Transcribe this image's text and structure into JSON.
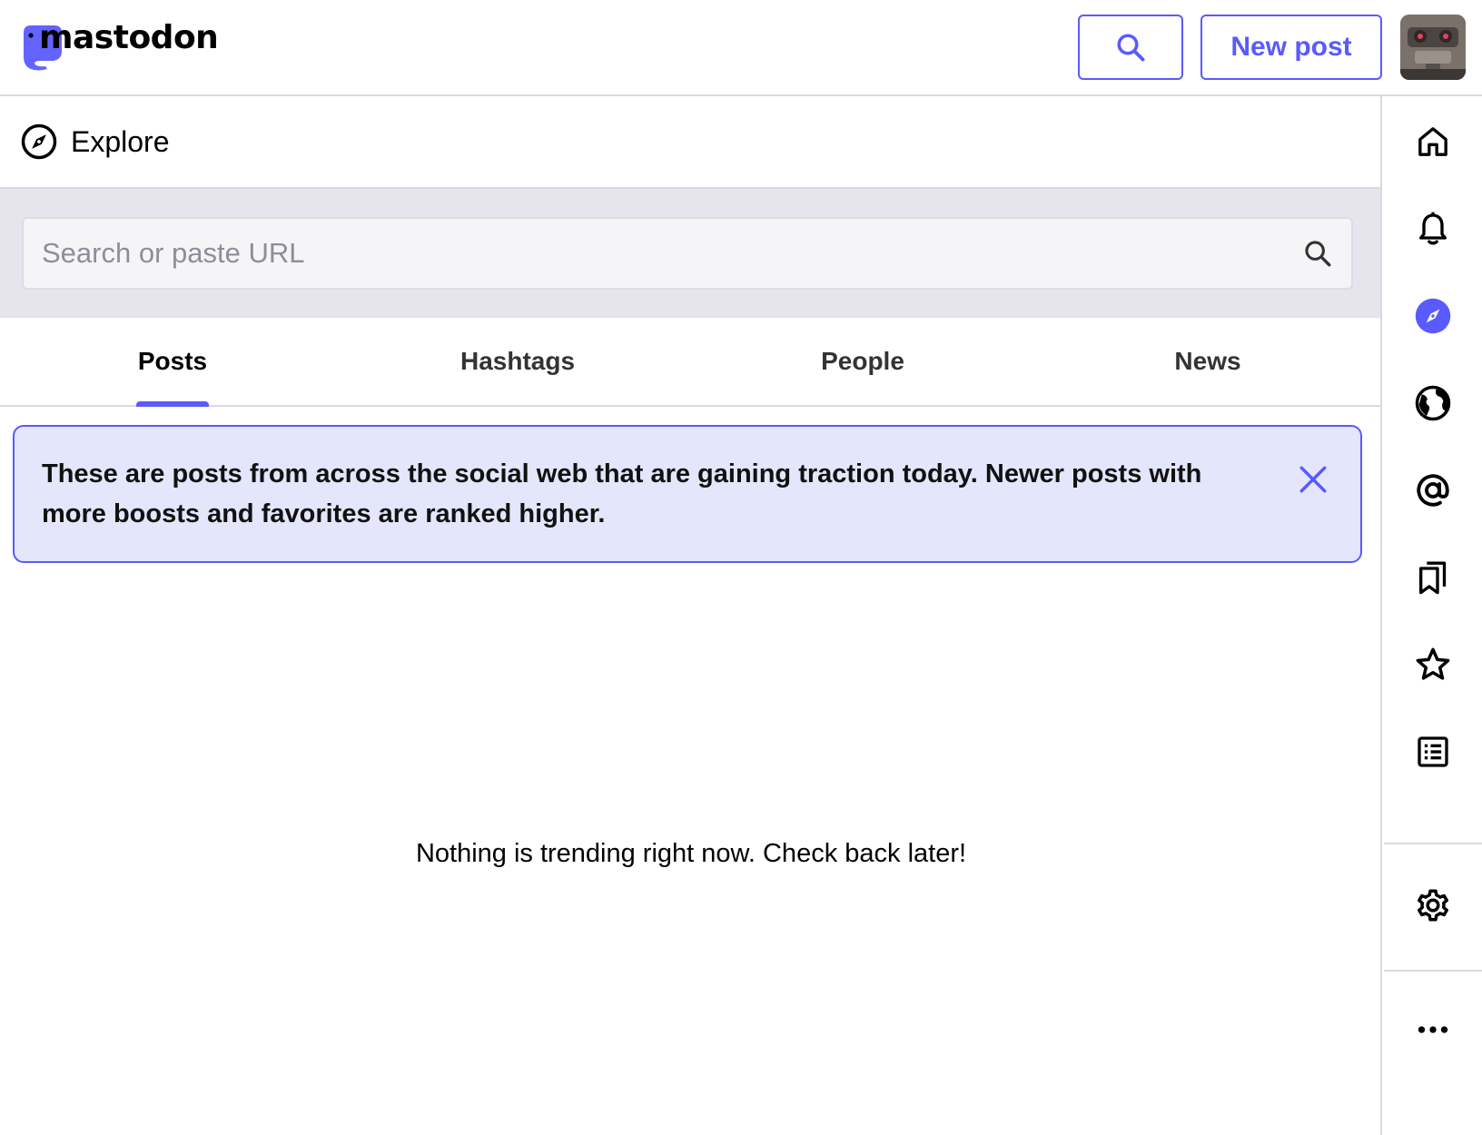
{
  "brand": {
    "logo_text": "mastodon",
    "accent": "#595aff"
  },
  "header": {
    "search_button_icon": "search-icon",
    "new_post_label": "New post",
    "avatar_icon": "avatar-image"
  },
  "column": {
    "title": "Explore",
    "icon": "compass-icon"
  },
  "search": {
    "placeholder": "Search or paste URL",
    "value": "",
    "icon": "search-icon"
  },
  "tabs": [
    {
      "label": "Posts",
      "active": true
    },
    {
      "label": "Hashtags",
      "active": false
    },
    {
      "label": "People",
      "active": false
    },
    {
      "label": "News",
      "active": false
    }
  ],
  "banner": {
    "text": "These are posts from across the social web that are gaining traction today. Newer posts with more boosts and favorites are ranked higher.",
    "close_icon": "close-icon"
  },
  "empty_message": "Nothing is trending right now. Check back later!",
  "right_nav": [
    {
      "name": "home",
      "icon": "home-icon",
      "active": false
    },
    {
      "name": "notifications",
      "icon": "bell-icon",
      "active": false
    },
    {
      "name": "explore",
      "icon": "compass-icon",
      "active": true
    },
    {
      "name": "live-feeds",
      "icon": "globe-icon",
      "active": false
    },
    {
      "name": "mentions",
      "icon": "at-icon",
      "active": false
    },
    {
      "name": "bookmarks",
      "icon": "bookmarks-icon",
      "active": false
    },
    {
      "name": "favorites",
      "icon": "star-icon",
      "active": false
    },
    {
      "name": "lists",
      "icon": "list-icon",
      "active": false
    },
    {
      "name": "preferences",
      "icon": "gear-icon",
      "active": false
    },
    {
      "name": "more",
      "icon": "more-icon",
      "active": false
    }
  ]
}
